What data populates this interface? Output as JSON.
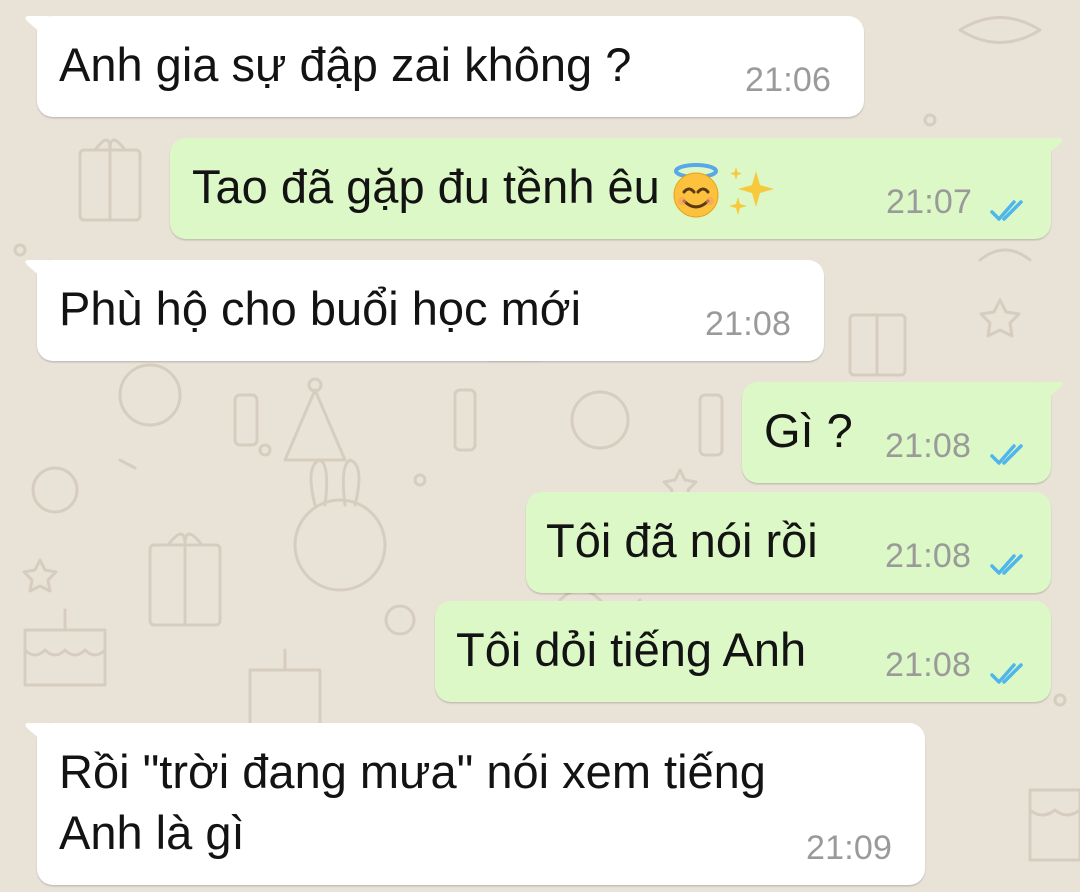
{
  "theme": {
    "wallpaper_color": "#e9e2d7",
    "incoming_bubble_color": "#ffffff",
    "outgoing_bubble_color": "#dcf8c6",
    "read_tick_color": "#4fb6ec"
  },
  "messages": [
    {
      "direction": "in",
      "text": "Anh gia sự đập zai không ?",
      "time": "21:06"
    },
    {
      "direction": "out",
      "text": "Tao đã gặp đu tềnh êu",
      "emojis": [
        "smiling-face-with-halo-icon",
        "sparkles-icon"
      ],
      "time": "21:07",
      "status": "read"
    },
    {
      "direction": "in",
      "text": "Phù hộ cho buổi học mới",
      "time": "21:08"
    },
    {
      "direction": "out",
      "text": "Gì ?",
      "time": "21:08",
      "status": "read"
    },
    {
      "direction": "out",
      "text": "Tôi đã nói rồi",
      "time": "21:08",
      "status": "read"
    },
    {
      "direction": "out",
      "text": "Tôi dỏi tiếng Anh",
      "time": "21:08",
      "status": "read"
    },
    {
      "direction": "in",
      "text_lines": [
        "Rồi \"trời đang mưa\" nói xem tiếng",
        "Anh là gì"
      ],
      "time": "21:09"
    }
  ]
}
